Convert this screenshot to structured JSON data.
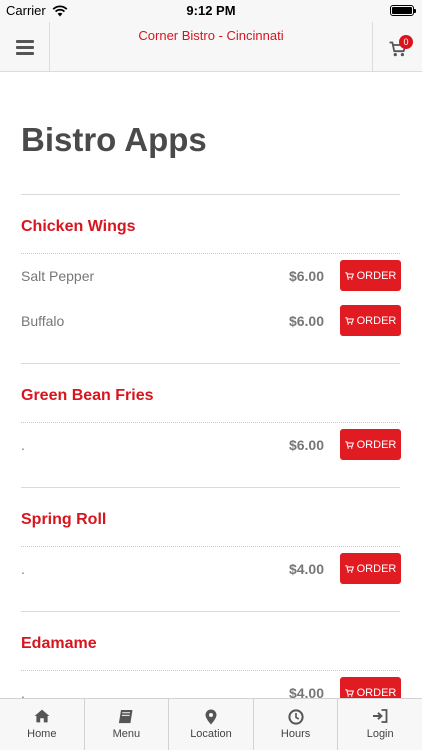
{
  "status_bar": {
    "carrier": "Carrier",
    "time": "9:12 PM"
  },
  "nav": {
    "title": "Corner Bistro - Cincinnati",
    "cart_count": "0"
  },
  "page": {
    "title": "Bistro Apps"
  },
  "order_label": "ORDER",
  "categories": [
    {
      "name": "Chicken Wings",
      "items": [
        {
          "name": "Salt Pepper",
          "price": "$6.00"
        },
        {
          "name": "Buffalo",
          "price": "$6.00"
        }
      ]
    },
    {
      "name": "Green Bean Fries",
      "items": [
        {
          "name": ".",
          "price": "$6.00"
        }
      ]
    },
    {
      "name": "Spring Roll",
      "items": [
        {
          "name": ".",
          "price": "$4.00"
        }
      ]
    },
    {
      "name": "Edamame",
      "items": [
        {
          "name": ".",
          "price": "$4.00"
        }
      ]
    }
  ],
  "tabs": [
    {
      "label": "Home",
      "icon": "home-icon"
    },
    {
      "label": "Menu",
      "icon": "book-icon"
    },
    {
      "label": "Location",
      "icon": "map-pin-icon"
    },
    {
      "label": "Hours",
      "icon": "clock-icon"
    },
    {
      "label": "Login",
      "icon": "login-icon"
    }
  ],
  "colors": {
    "accent": "#d8151f",
    "button": "#e11b22",
    "bar_bg": "#f7f7f7"
  }
}
